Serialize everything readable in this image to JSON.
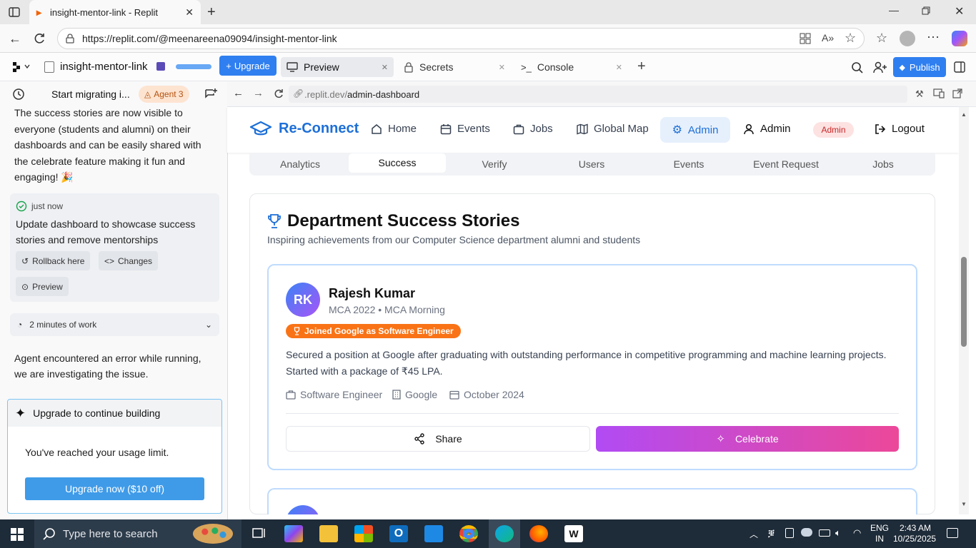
{
  "browser": {
    "tab_title": "insight-mentor-link - Replit",
    "url": "https://replit.com/@meenareena09094/insight-mentor-link"
  },
  "replit": {
    "project_name": "insight-mentor-link",
    "upgrade_label": "Upgrade",
    "tabs": [
      {
        "label": "Preview"
      },
      {
        "label": "Secrets"
      },
      {
        "label": "Console"
      }
    ],
    "publish_label": "Publish"
  },
  "agent": {
    "header_title": "Start migrating i...",
    "agent_badge": "Agent 3",
    "message": "The success stories are now visible to everyone (students and alumni) on their dashboards and can be easily shared with the celebrate feature making it fun and engaging! 🎉",
    "checkpoint_time": "just now",
    "checkpoint_text": "Update dashboard to showcase success stories and remove mentorships",
    "rollback_label": "Rollback here",
    "changes_label": "Changes",
    "preview_label": "Preview",
    "work_summary": "2 minutes of work",
    "error_text": "Agent encountered an error while running, we are investigating the issue.",
    "upgrade_title": "Upgrade to continue building",
    "limit_text": "You've reached your usage limit.",
    "upgrade_now_label": "Upgrade now ($10 off)"
  },
  "preview": {
    "url_dim": ".replit.dev/",
    "url_path": "admin-dashboard"
  },
  "site": {
    "brand": "Re-Connect",
    "nav": [
      {
        "label": "Home",
        "icon": "home-icon"
      },
      {
        "label": "Events",
        "icon": "calendar-icon"
      },
      {
        "label": "Jobs",
        "icon": "briefcase-icon"
      },
      {
        "label": "Global Map",
        "icon": "map-icon"
      },
      {
        "label": "Admin",
        "icon": "gear-icon"
      }
    ],
    "user_name": "Admin",
    "role_badge": "Admin",
    "logout_label": "Logout",
    "subtabs": [
      "Analytics",
      "Success",
      "Verify",
      "Users",
      "Events",
      "Event Request",
      "Jobs"
    ],
    "active_subtab": "Success",
    "section_title": "Department Success Stories",
    "section_subtitle": "Inspiring achievements from our Computer Science department alumni and students",
    "story": {
      "initials": "RK",
      "name": "Rajesh Kumar",
      "meta": "MCA 2022 • MCA Morning",
      "badge": "Joined Google as Software Engineer",
      "description": "Secured a position at Google after graduating with outstanding performance in competitive programming and machine learning projects. Started with a package of ₹45 LPA.",
      "role": "Software Engineer",
      "company": "Google",
      "date": "October 2024",
      "share_label": "Share",
      "celebrate_label": "Celebrate"
    }
  },
  "taskbar": {
    "search_placeholder": "Type here to search",
    "lang_line1": "ENG",
    "lang_line2": "IN",
    "time": "2:43 AM",
    "date": "10/25/2025"
  },
  "colors": {
    "brand_blue": "#1d6fd8",
    "replit_accent": "#0079f2",
    "celebrate_gradient_start": "#b14bf4",
    "celebrate_gradient_end": "#ec4899",
    "badge_orange": "#f97316"
  }
}
